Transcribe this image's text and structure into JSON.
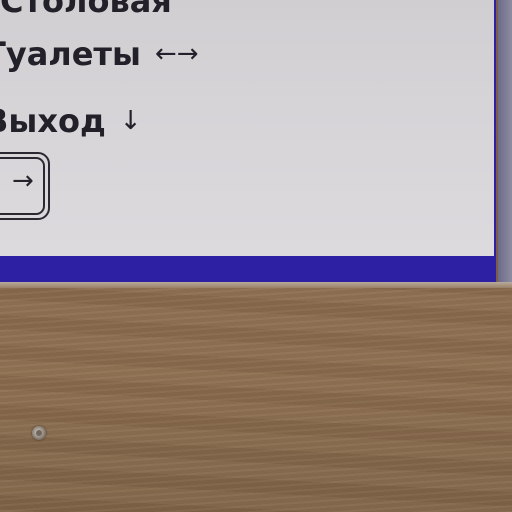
{
  "sign": {
    "line_1": "Столовая",
    "line_2": "Туалеты",
    "line_2_arrow": "←→",
    "line_3": "Выход",
    "line_3_arrow": "↓",
    "exit_arrow": "→"
  },
  "colors": {
    "sign_border": "#2e20a2",
    "sign_background": "#d4d2d5",
    "text": "#222028",
    "wood": "#8a6c4f"
  },
  "icons": [
    "double-arrow-icon",
    "down-arrow-icon",
    "exit-door-icon",
    "screw-icon"
  ]
}
